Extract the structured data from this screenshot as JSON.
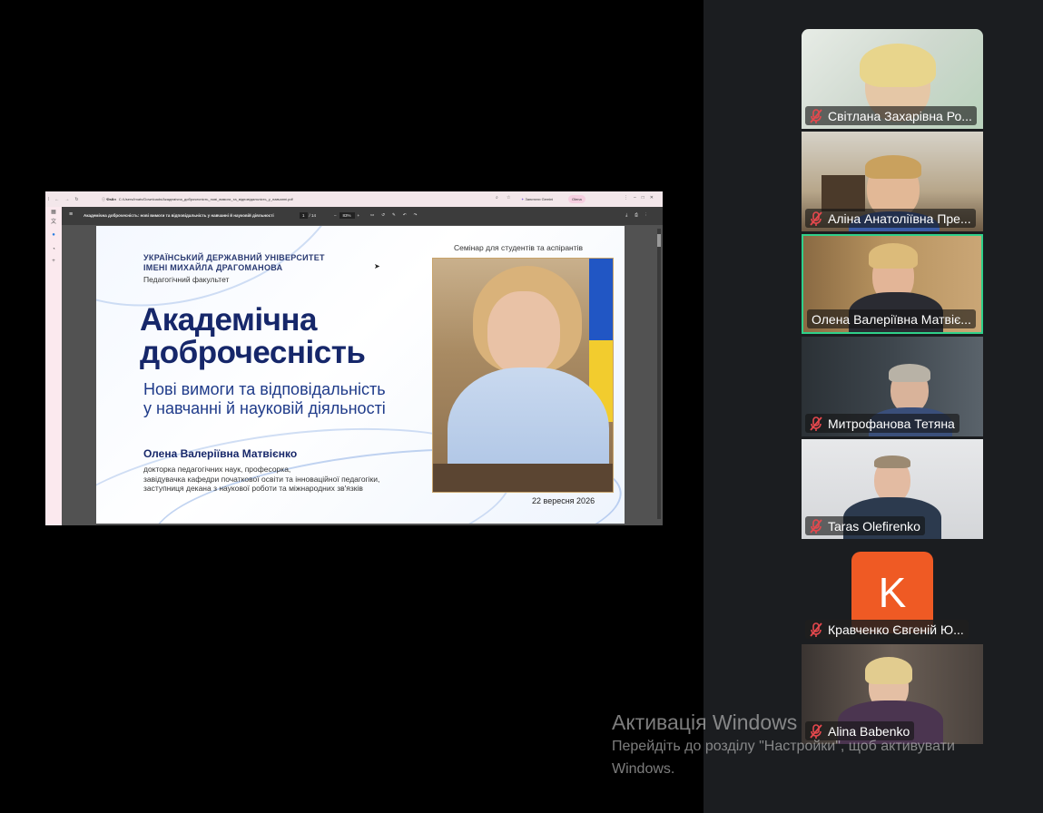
{
  "screen_share": {
    "browser": {
      "url_scheme": "Файл",
      "url": "C:/Users/Imatv/Downloads/Академічна_доброчесність_нові_вимоги_та_відповідальність_у_навчанні.pdf",
      "gemini_label": "Запитати Gemini",
      "profile_label": "Olena"
    },
    "pdf_toolbar": {
      "title": "Академічна доброчесність: нові вимоги та відповідальність у навчанні й науковій діяльності",
      "page_current": "1",
      "page_total": "/ 14",
      "zoom": "83%"
    },
    "slide": {
      "university_line1": "УКРАЇНСЬКИЙ ДЕРЖАВНИЙ УНІВЕРСИТЕТ",
      "university_line2": "ІМЕНІ МИХАЙЛА ДРАГОМАНОВА",
      "faculty": "Педагогічний факультет",
      "seminar": "Семінар для студентів та аспірантів",
      "title_line1": "Академічна",
      "title_line2": "доброчесність",
      "subtitle_line1": "Нові вимоги та відповідальність",
      "subtitle_line2": "у навчанні й науковій діяльності",
      "speaker": "Олена Валеріївна Матвієнко",
      "cred_line1": "докторка педагогічних наук, професорка,",
      "cred_line2": "завідувачка кафедри початкової освіти та інноваційної педагогіки,",
      "cred_line3": "заступниця декана з наукової роботи та міжнародних зв'язків",
      "date": "22 вересня 2026"
    }
  },
  "participants": [
    {
      "name": "Світлана Захарівна Ро...",
      "muted": true
    },
    {
      "name": "Аліна Анатоліївна Пре...",
      "muted": true
    },
    {
      "name": "Олена Валеріївна Матвіє...",
      "muted": false,
      "active_speaker": true
    },
    {
      "name": "Митрофанова Тетяна",
      "muted": true
    },
    {
      "name": "Taras Olefirenko",
      "muted": true
    },
    {
      "name": "Кравченко Євгеній Ю...",
      "muted": true,
      "avatar_letter": "K",
      "avatar_color": "#ef5a24"
    },
    {
      "name": "Alina Babenko",
      "muted": true
    }
  ],
  "windows_watermark": {
    "title": "Активація Windows",
    "line1": "Перейдіть до розділу \"Настройки\", щоб активувати",
    "line2": "Windows."
  },
  "colors": {
    "active_speaker_border": "#2fd08a",
    "muted_icon": "#e5484d",
    "panel_bg": "#1b1d20"
  }
}
